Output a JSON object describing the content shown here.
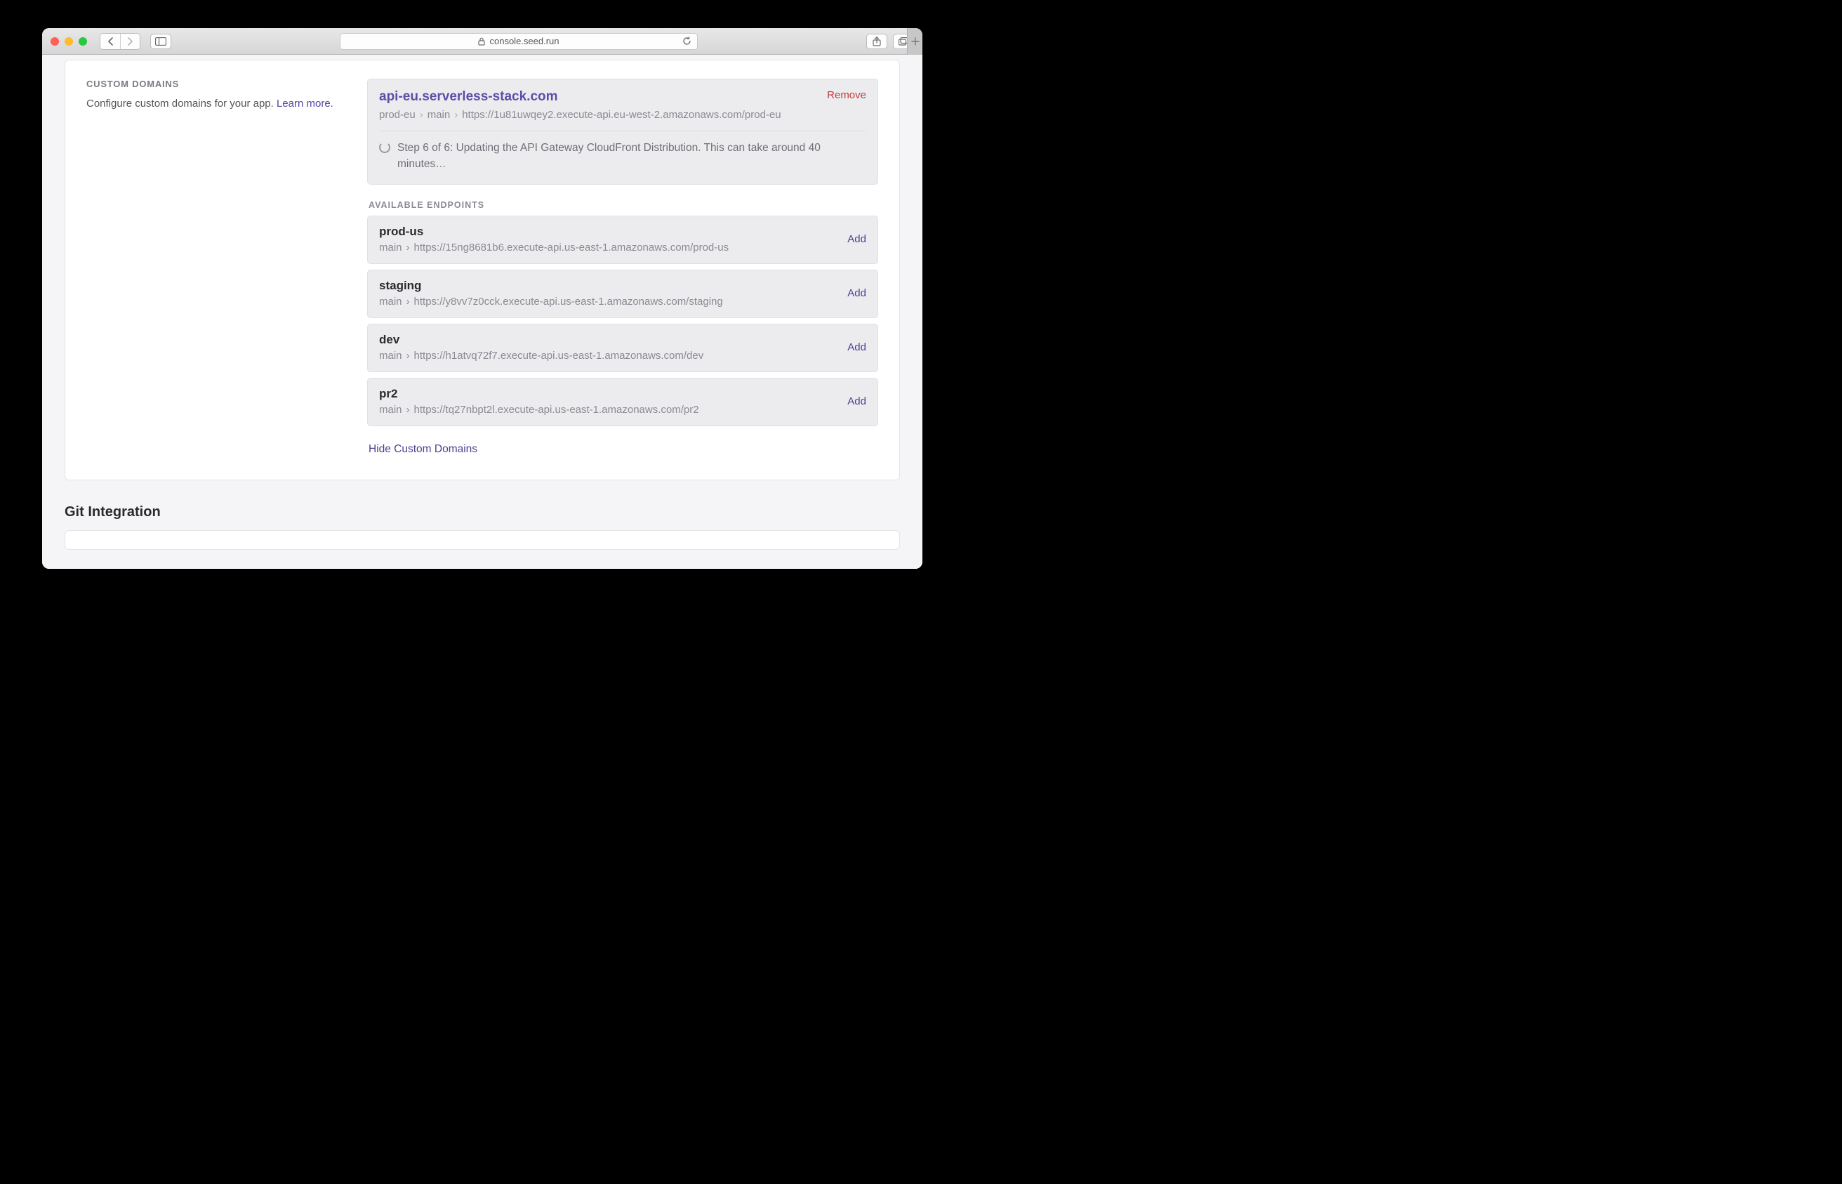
{
  "browser": {
    "url_display": "console.seed.run"
  },
  "customDomains": {
    "heading": "CUSTOM DOMAINS",
    "description": "Configure custom domains for your app. ",
    "learn_more": "Learn more.",
    "configured": {
      "domain": "api-eu.serverless-stack.com",
      "stage": "prod-eu",
      "service": "main",
      "endpoint_url": "https://1u81uwqey2.execute-api.eu-west-2.amazonaws.com/prod-eu",
      "remove_label": "Remove",
      "status_text": "Step 6 of 6: Updating the API Gateway CloudFront Distribution. This can take around 40 minutes…"
    },
    "available_label": "AVAILABLE ENDPOINTS",
    "endpoints": [
      {
        "name": "prod-us",
        "service": "main",
        "url": "https://15ng8681b6.execute-api.us-east-1.amazonaws.com/prod-us",
        "action": "Add"
      },
      {
        "name": "staging",
        "service": "main",
        "url": "https://y8vv7z0cck.execute-api.us-east-1.amazonaws.com/staging",
        "action": "Add"
      },
      {
        "name": "dev",
        "service": "main",
        "url": "https://h1atvq72f7.execute-api.us-east-1.amazonaws.com/dev",
        "action": "Add"
      },
      {
        "name": "pr2",
        "service": "main",
        "url": "https://tq27nbpt2l.execute-api.us-east-1.amazonaws.com/pr2",
        "action": "Add"
      }
    ],
    "hide_label": "Hide Custom Domains"
  },
  "gitIntegration": {
    "heading": "Git Integration"
  }
}
